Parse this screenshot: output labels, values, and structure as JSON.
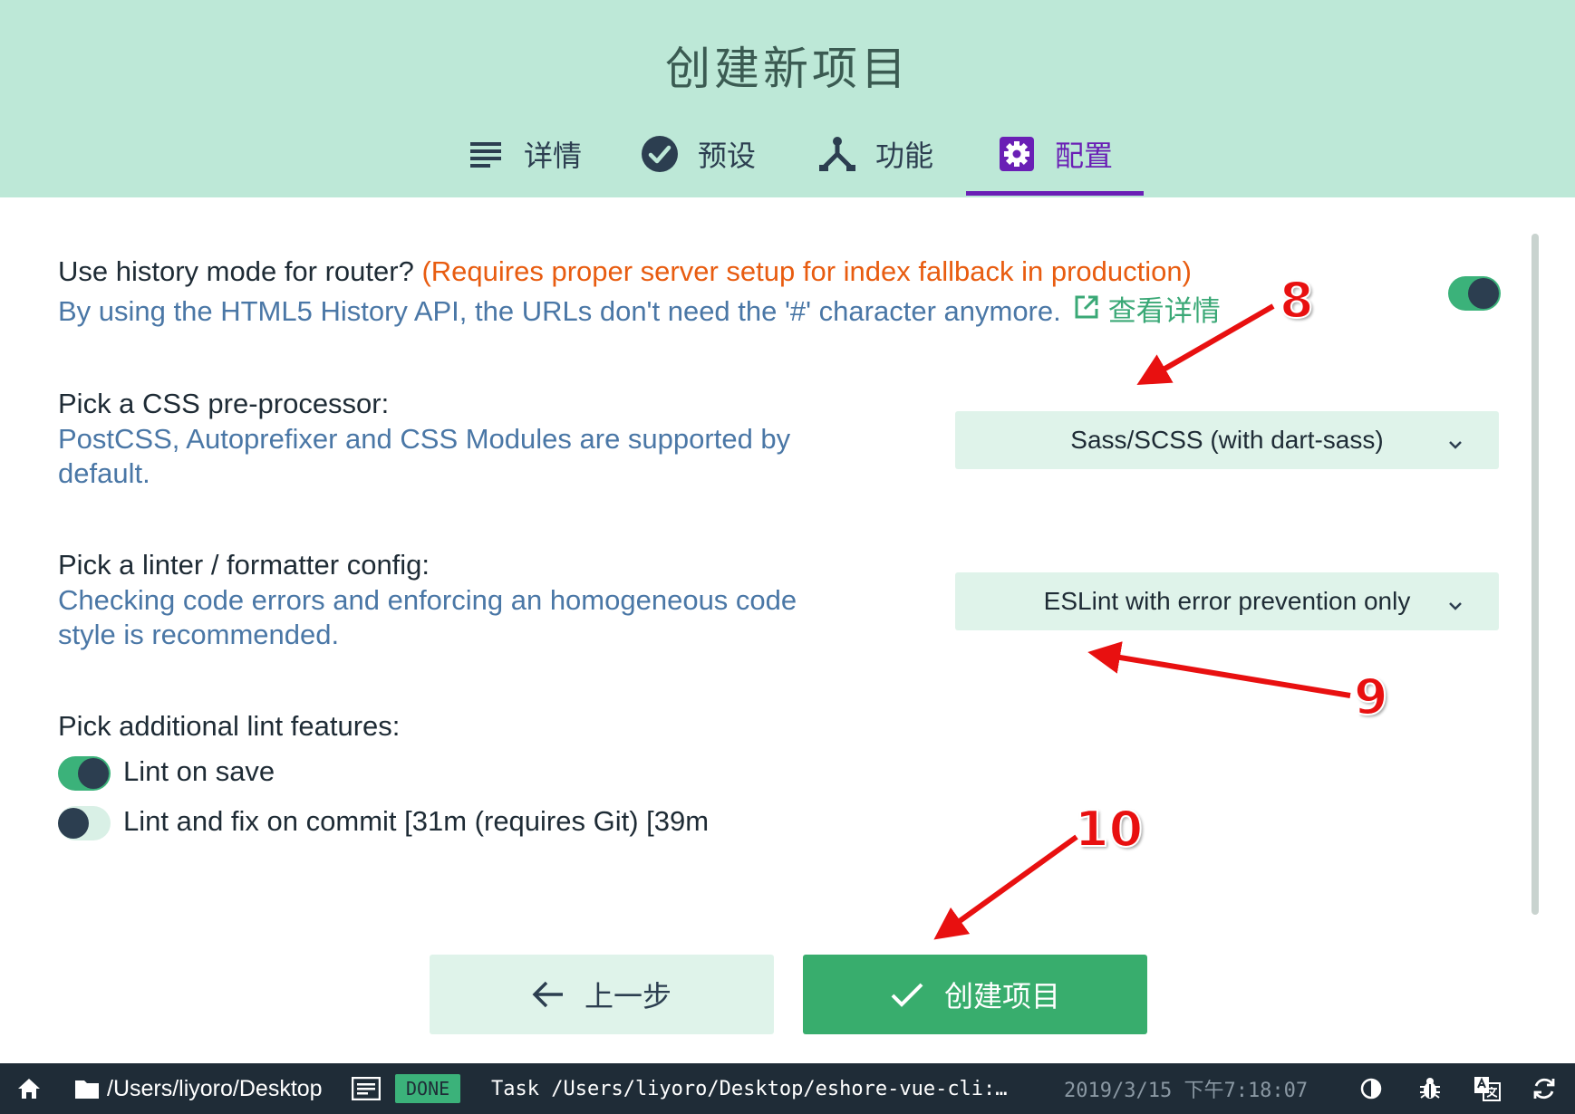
{
  "header": {
    "title": "创建新项目",
    "tabs": [
      {
        "label": "详情",
        "icon": "list-icon"
      },
      {
        "label": "预设",
        "icon": "check-circle-icon"
      },
      {
        "label": "功能",
        "icon": "fork-icon"
      },
      {
        "label": "配置",
        "icon": "gear-icon",
        "active": true
      }
    ]
  },
  "router": {
    "title": "Use history mode for router?",
    "warning": "(Requires proper server setup for index fallback in production)",
    "description": "By using the HTML5 History API, the URLs don't need the '#' character anymore.",
    "more_link": "查看详情",
    "enabled": true
  },
  "css": {
    "title": "Pick a CSS pre-processor:",
    "description_line1": "PostCSS, Autoprefixer and CSS Modules are supported by",
    "description_line2": "default.",
    "selected": "Sass/SCSS (with dart-sass)"
  },
  "linter": {
    "title": "Pick a linter / formatter config:",
    "description_line1": "Checking code errors and enforcing an homogeneous code",
    "description_line2": "style is recommended.",
    "selected": "ESLint with error prevention only"
  },
  "lint_features": {
    "title": "Pick additional lint features:",
    "items": [
      {
        "label": "Lint on save",
        "enabled": true
      },
      {
        "label": "Lint and fix on commit [31m (requires Git) [39m",
        "enabled": false
      }
    ]
  },
  "buttons": {
    "prev": "上一步",
    "create": "创建项目"
  },
  "annotations": [
    "8",
    "9",
    "10"
  ],
  "statusbar": {
    "path": "/Users/liyoro/Desktop",
    "status": "DONE",
    "task": "Task /Users/liyoro/Desktop/eshore-vue-cli:…",
    "time": "2019/3/15 下午7:18:07"
  },
  "colors": {
    "header_bg": "#bde8d7",
    "accent": "#6a1fb5",
    "primary": "#38ad6d",
    "warning": "#e85c10",
    "statusbar_bg": "#1f2c37"
  }
}
